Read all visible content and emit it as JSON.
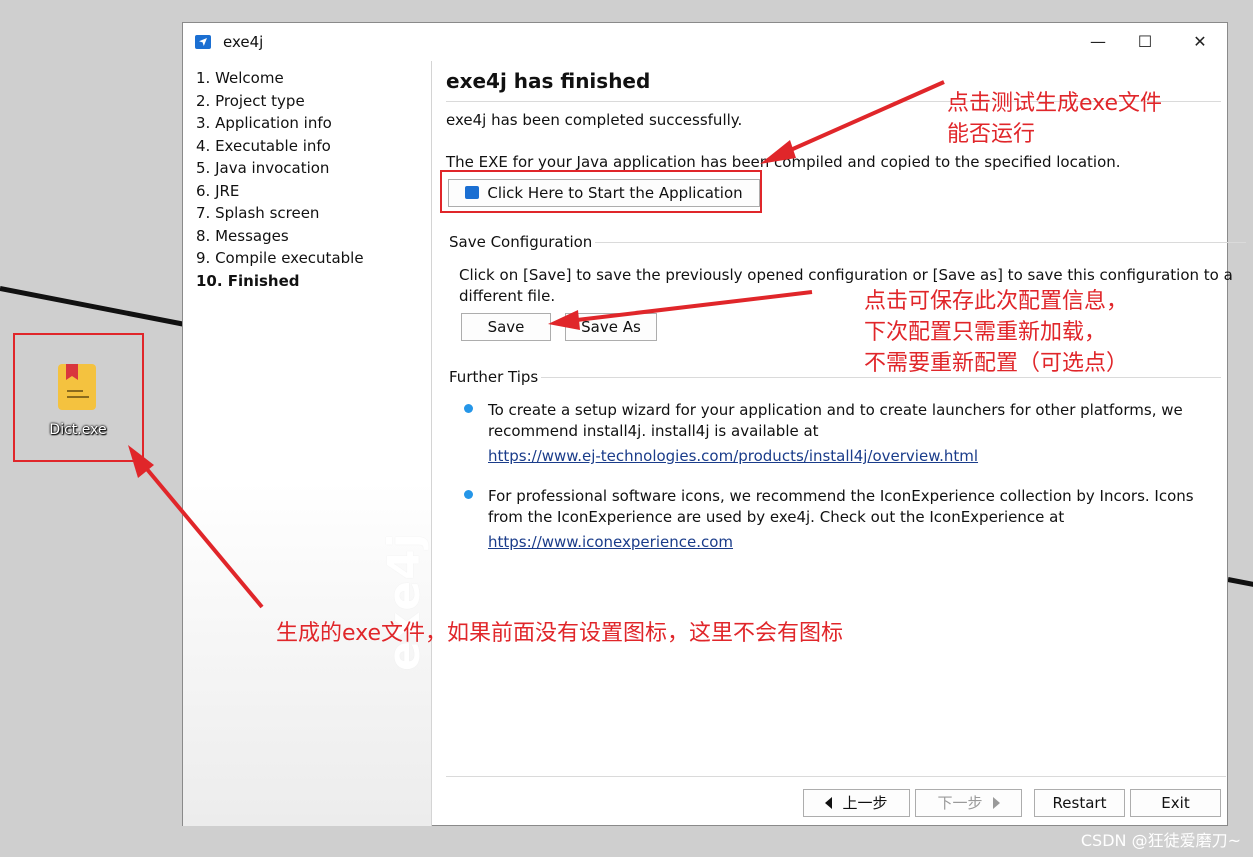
{
  "desktop": {
    "file_label": "Dict.exe",
    "icon": "bookmark-app-icon",
    "watermark": "CSDN @狂徒爱磨刀~"
  },
  "window": {
    "title": "exe4j",
    "controls": {
      "minimize": "—",
      "maximize": "☐",
      "close": "✕"
    }
  },
  "sidebar": {
    "steps": [
      "1. Welcome",
      "2. Project type",
      "3. Application info",
      "4. Executable info",
      "5. Java invocation",
      "6. JRE",
      "7. Splash screen",
      "8. Messages",
      "9. Compile executable",
      "10. Finished"
    ],
    "watermark": "exe4j"
  },
  "main": {
    "header": "exe4j has finished",
    "completed_text": "exe4j has been completed successfully.",
    "exe_text": "The EXE for your Java application has been compiled and copied to the specified location.",
    "start_button": "Click Here to Start the Application",
    "save_section": {
      "title": "Save Configuration",
      "desc_line1": "Click on [Save] to save the previously opened configuration or [Save as] to save this configuration to a",
      "desc_line2": "different file.",
      "save_button": "Save",
      "save_as_button": "Save As"
    },
    "tips_section": {
      "title": "Further Tips",
      "tip1_line1": "To create a setup wizard for your application and to create launchers for other platforms, we",
      "tip1_line2": "recommend install4j. install4j is available at",
      "tip1_link": "https://www.ej-technologies.com/products/install4j/overview.html",
      "tip2_line1": "For professional software icons, we recommend the IconExperience collection by Incors. Icons",
      "tip2_line2": "from the IconExperience are used by exe4j. Check out the IconExperience at",
      "tip2_link": "https://www.iconexperience.com"
    }
  },
  "footer": {
    "back_button": "上一步",
    "next_button": "下一步",
    "restart_button": "Restart",
    "exit_button": "Exit"
  },
  "annotations": {
    "test_line1": "点击测试生成exe文件",
    "test_line2": "能否运行",
    "save_line1": "点击可保存此次配置信息，",
    "save_line2": "下次配置只需重新加载，",
    "save_line3": "不需要重新配置（可选点）",
    "exe_note": "生成的exe文件，如果前面没有设置图标，这里不会有图标",
    "color": "#e0262a"
  }
}
